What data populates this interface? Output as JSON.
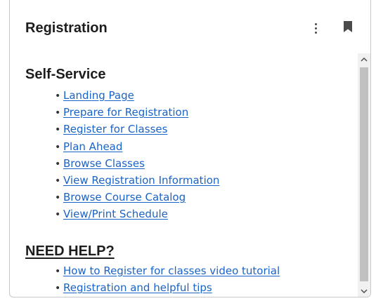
{
  "card": {
    "title": "Registration",
    "menu_icon": "more-vertical-icon",
    "bookmark_icon": "bookmark-icon"
  },
  "self_service": {
    "heading": "Self-Service",
    "links": [
      {
        "label": "Landing Page"
      },
      {
        "label": "Prepare for Registration"
      },
      {
        "label": "Register for Classes"
      },
      {
        "label": "Plan Ahead"
      },
      {
        "label": "Browse Classes"
      },
      {
        "label": "View Registration Information"
      },
      {
        "label": "Browse Course Catalog"
      },
      {
        "label": "View/Print Schedule"
      }
    ]
  },
  "need_help": {
    "heading": "NEED HELP?",
    "links": [
      {
        "label": "How to Register for classes video tutorial"
      },
      {
        "label": "Registration and helpful tips"
      }
    ]
  },
  "colors": {
    "link": "#1a63c7",
    "heading": "#1d1d1d",
    "scroll_thumb": "#c1c1c1"
  },
  "scrollbar": {
    "up_icon": "chevron-up-icon",
    "down_icon": "chevron-down-icon"
  }
}
